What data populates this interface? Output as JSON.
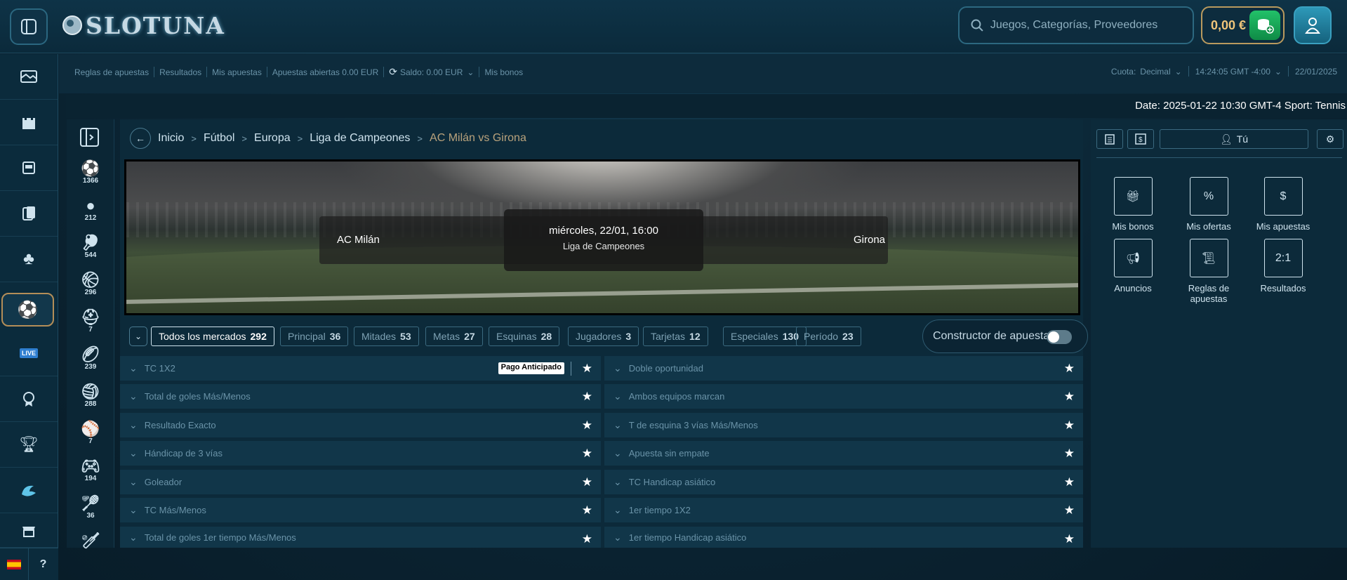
{
  "header": {
    "logo": "SLOTUNA",
    "search_placeholder": "Juegos, Categorías, Proveedores",
    "balance": "0,00 €",
    "accent": "#b99a5e"
  },
  "topbar": {
    "links": [
      "Reglas de apuestas",
      "Resultados",
      "Mis apuestas",
      "Apuestas abiertas 0.00 EUR",
      "Saldo: 0.00 EUR",
      "Mis bonos"
    ],
    "odds_label": "Cuota:",
    "odds_value": "Decimal",
    "time": "14:24:05 GMT -4:00",
    "date": "22/01/2025"
  },
  "dateline": "Date: 2025-01-22 10:30 GMT-4 Sport: Tennis",
  "sidebar": {
    "items": [
      "promotions-icon",
      "casino-icon",
      "slots-icon",
      "cards-icon",
      "poker-icon",
      "sports-icon",
      "live-icon",
      "vip-icon",
      "tournaments-icon",
      "crash-icon",
      "shop-icon"
    ],
    "live_label": "LIVE",
    "help": "?"
  },
  "sports": [
    {
      "icon": "soccer-icon",
      "count": "1366"
    },
    {
      "icon": "tennis-ball-icon",
      "count": "212"
    },
    {
      "icon": "table-tennis-icon",
      "count": "544"
    },
    {
      "icon": "basketball-icon",
      "count": "296"
    },
    {
      "icon": "american-football-icon",
      "count": "7"
    },
    {
      "icon": "rugby-ball-icon",
      "count": "239"
    },
    {
      "icon": "volleyball-icon",
      "count": "288"
    },
    {
      "icon": "baseball-icon",
      "count": "7"
    },
    {
      "icon": "esports-icon",
      "count": "194"
    },
    {
      "icon": "badminton-icon",
      "count": "36"
    },
    {
      "icon": "cricket-icon",
      "count": ""
    }
  ],
  "breadcrumb": [
    "Inicio",
    "Fútbol",
    "Europa",
    "Liga de Campeones",
    "AC Milán vs Girona"
  ],
  "match": {
    "home": "AC Milán",
    "away": "Girona",
    "date": "miércoles, 22/01, 16:00",
    "league": "Liga de Campeones"
  },
  "tabs": [
    {
      "label": "Todos los mercados",
      "count": "292"
    },
    {
      "label": "Principal",
      "count": "36"
    },
    {
      "label": "Mitades",
      "count": "53"
    },
    {
      "label": "Metas",
      "count": "27"
    },
    {
      "label": "Esquinas",
      "count": "28"
    },
    {
      "label": "Jugadores",
      "count": "3"
    },
    {
      "label": "Tarjetas",
      "count": "12"
    },
    {
      "label": "Especiales",
      "count": "130"
    },
    {
      "label": "Período",
      "count": "23"
    }
  ],
  "builder_label": "Constructor de apuestas",
  "early_pay": "Pago Anticipado",
  "markets_left": [
    "TC 1X2",
    "Total de goles Más/Menos",
    "Resultado Exacto",
    "Hándicap de 3 vías",
    "Goleador",
    "TC Más/Menos",
    "Total de goles 1er tiempo Más/Menos"
  ],
  "markets_right": [
    "Doble oportunidad",
    "Ambos equipos marcan",
    "T de esquina 3 vías Más/Menos",
    "Apuesta sin empate",
    "TC Handicap asiático",
    "1er tiempo 1X2",
    "1er tiempo Handicap asiático"
  ],
  "rpanel": {
    "user_tab": "Tú",
    "items": [
      "Mis bonos",
      "Mis ofertas",
      "Mis apuestas",
      "Anuncios",
      "Reglas de apuestas",
      "Resultados"
    ],
    "results_glyph": "2:1"
  }
}
